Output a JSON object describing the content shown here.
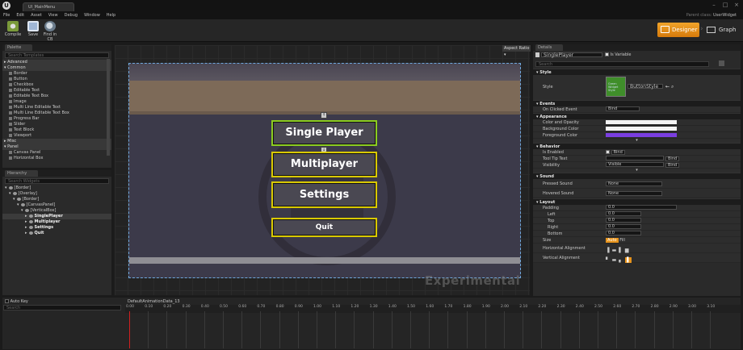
{
  "window": {
    "tab": "UI_MainMenu",
    "min": "–",
    "max": "□",
    "close": "×"
  },
  "menu": {
    "items": [
      "File",
      "Edit",
      "Asset",
      "View",
      "Debug",
      "Window",
      "Help"
    ],
    "parent_class_label": "Parent class:",
    "parent_class": "UserWidget"
  },
  "toolbar": {
    "compile": "Compile",
    "save": "Save",
    "find": "Find in CB",
    "designer": "Designer",
    "graph": "Graph"
  },
  "palette": {
    "title": "Palette",
    "search_placeholder": "Search Templates",
    "sections": [
      {
        "label": "Advanced",
        "items": []
      },
      {
        "label": "Common",
        "items": [
          "Border",
          "Button",
          "Checkbox",
          "Editable Text",
          "Editable Text Box",
          "Image",
          "Multi Line Editable Text",
          "Multi Line Editable Text Box",
          "Progress Bar",
          "Slider",
          "Text Block",
          "Viewport"
        ]
      },
      {
        "label": "Misc",
        "items": []
      },
      {
        "label": "Panel",
        "items": [
          "Canvas Panel",
          "Horizontal Box"
        ]
      }
    ]
  },
  "hierarchy": {
    "title": "Hierarchy",
    "search_placeholder": "Search Widgets",
    "nodes": [
      "[Border]",
      "[Overlay]",
      "[Border]",
      "[CanvasPanel]",
      "[VerticalBox]",
      "SinglePlayer",
      "Multiplayer",
      "Settings",
      "Quit"
    ]
  },
  "designer": {
    "aspect_ratio": "Aspect Ratio",
    "buttons": {
      "single": "Single Player",
      "multi": "Multiplayer",
      "settings": "Settings",
      "quit": "Quit"
    },
    "watermark": "Experimental"
  },
  "details": {
    "title": "Details",
    "name_value": "SinglePlayer",
    "is_variable": "Is Variable",
    "search_placeholder": "Search",
    "style": {
      "header": "Style",
      "label": "Style",
      "thumb": "Green Widget Style",
      "value": "ButtonStyle"
    },
    "events": {
      "header": "Events",
      "on_clicked": "On Clicked Event",
      "on_clicked_value": "Bind"
    },
    "appearance": {
      "header": "Appearance",
      "color_opacity": "Color and Opacity",
      "background": "Background Color",
      "foreground": "Foreground Color"
    },
    "behavior": {
      "header": "Behavior",
      "is_enabled": "Is Enabled",
      "tooltip": "Tool Tip Text",
      "visibility": "Visibility",
      "visibility_value": "Visible",
      "bind": "Bind"
    },
    "sound": {
      "header": "Sound",
      "pressed": "Pressed Sound",
      "hovered": "Hovered Sound",
      "none": "None"
    },
    "layout": {
      "header": "Layout",
      "padding": "Padding",
      "left": "Left",
      "top": "Top",
      "right": "Right",
      "bottom": "Bottom",
      "size": "Size",
      "auto": "Auto",
      "fill": "Fill",
      "h_align": "Horizontal Alignment",
      "v_align": "Vertical Alignment",
      "zero": "0.0"
    }
  },
  "timeline": {
    "auto_key": "Auto Key",
    "search_placeholder": "Search",
    "animation": "DefaultAnimationData_13",
    "ticks": [
      "0.00",
      "0.10",
      "0.20",
      "0.30",
      "0.40",
      "0.50",
      "0.60",
      "0.70",
      "0.80",
      "0.90",
      "1.00",
      "1.10",
      "1.20",
      "1.30",
      "1.40",
      "1.50",
      "1.60",
      "1.70",
      "1.80",
      "1.90",
      "2.00",
      "2.10",
      "2.20",
      "2.30",
      "2.40",
      "2.50",
      "2.60",
      "2.70",
      "2.80",
      "2.90",
      "3.00",
      "3.10"
    ]
  },
  "colors": {
    "accent": "#e8941c",
    "selection_outline": "#d9c900",
    "foreground_color": "#7a3ee0"
  }
}
